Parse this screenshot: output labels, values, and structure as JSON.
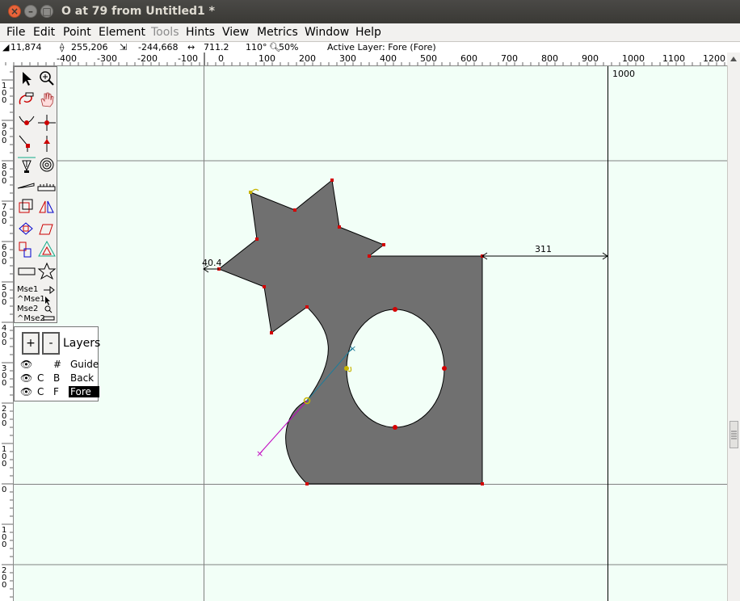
{
  "window": {
    "title": "O at 79 from Untitled1 *"
  },
  "menu": [
    {
      "label": "File",
      "enabled": true
    },
    {
      "label": "Edit",
      "enabled": true
    },
    {
      "label": "Point",
      "enabled": true
    },
    {
      "label": "Element",
      "enabled": true
    },
    {
      "label": "Tools",
      "enabled": false
    },
    {
      "label": "Hints",
      "enabled": true
    },
    {
      "label": "View",
      "enabled": true
    },
    {
      "label": "Metrics",
      "enabled": true
    },
    {
      "label": "Window",
      "enabled": true
    },
    {
      "label": "Help",
      "enabled": true
    }
  ],
  "info": {
    "cursor": "11,874",
    "point": "255,206",
    "delta": "-244,668",
    "distance": "711.2",
    "angle": "110°",
    "zoom": "50%",
    "active_layer": "Active Layer: Fore (Fore)"
  },
  "ruler": {
    "h_ticks": [
      "-400",
      "-300",
      "-200",
      "-100",
      "0",
      "100",
      "200",
      "300",
      "400",
      "500",
      "600",
      "700",
      "800",
      "900",
      "1000",
      "1100",
      "1200"
    ],
    "v_digits": [
      [
        "1",
        "0",
        "0"
      ],
      [
        "9",
        "0",
        "0"
      ],
      [
        "8",
        "0",
        "0"
      ],
      [
        "7",
        "0",
        "0"
      ],
      [
        "6",
        "0",
        "0"
      ],
      [
        "5",
        "0",
        "0"
      ],
      [
        "4",
        "0",
        "0"
      ],
      [
        "3",
        "0",
        "0"
      ],
      [
        "2",
        "0",
        "0"
      ],
      [
        "1",
        "0",
        "0"
      ],
      [
        "0"
      ],
      [
        "1",
        "0",
        "0"
      ],
      [
        "2",
        "0",
        "0"
      ]
    ]
  },
  "canvas": {
    "advance_label": "1000",
    "right_bearing_label": "311",
    "left_bearing_label": "40.4"
  },
  "tools": {
    "mouse": [
      "Mse1",
      "^Mse1",
      "Mse2",
      "^Mse2"
    ]
  },
  "layers": {
    "title": "Layers",
    "add": "+",
    "remove": "-",
    "rows": [
      {
        "col1": "",
        "col2": "#",
        "name": "Guide"
      },
      {
        "col1": "C",
        "col2": "B",
        "name": "Back"
      },
      {
        "col1": "C",
        "col2": "F",
        "name": "Fore"
      }
    ]
  },
  "colors": {
    "glyph_fill": "#707070",
    "point": "#d40000",
    "background": "#f2fff7"
  }
}
